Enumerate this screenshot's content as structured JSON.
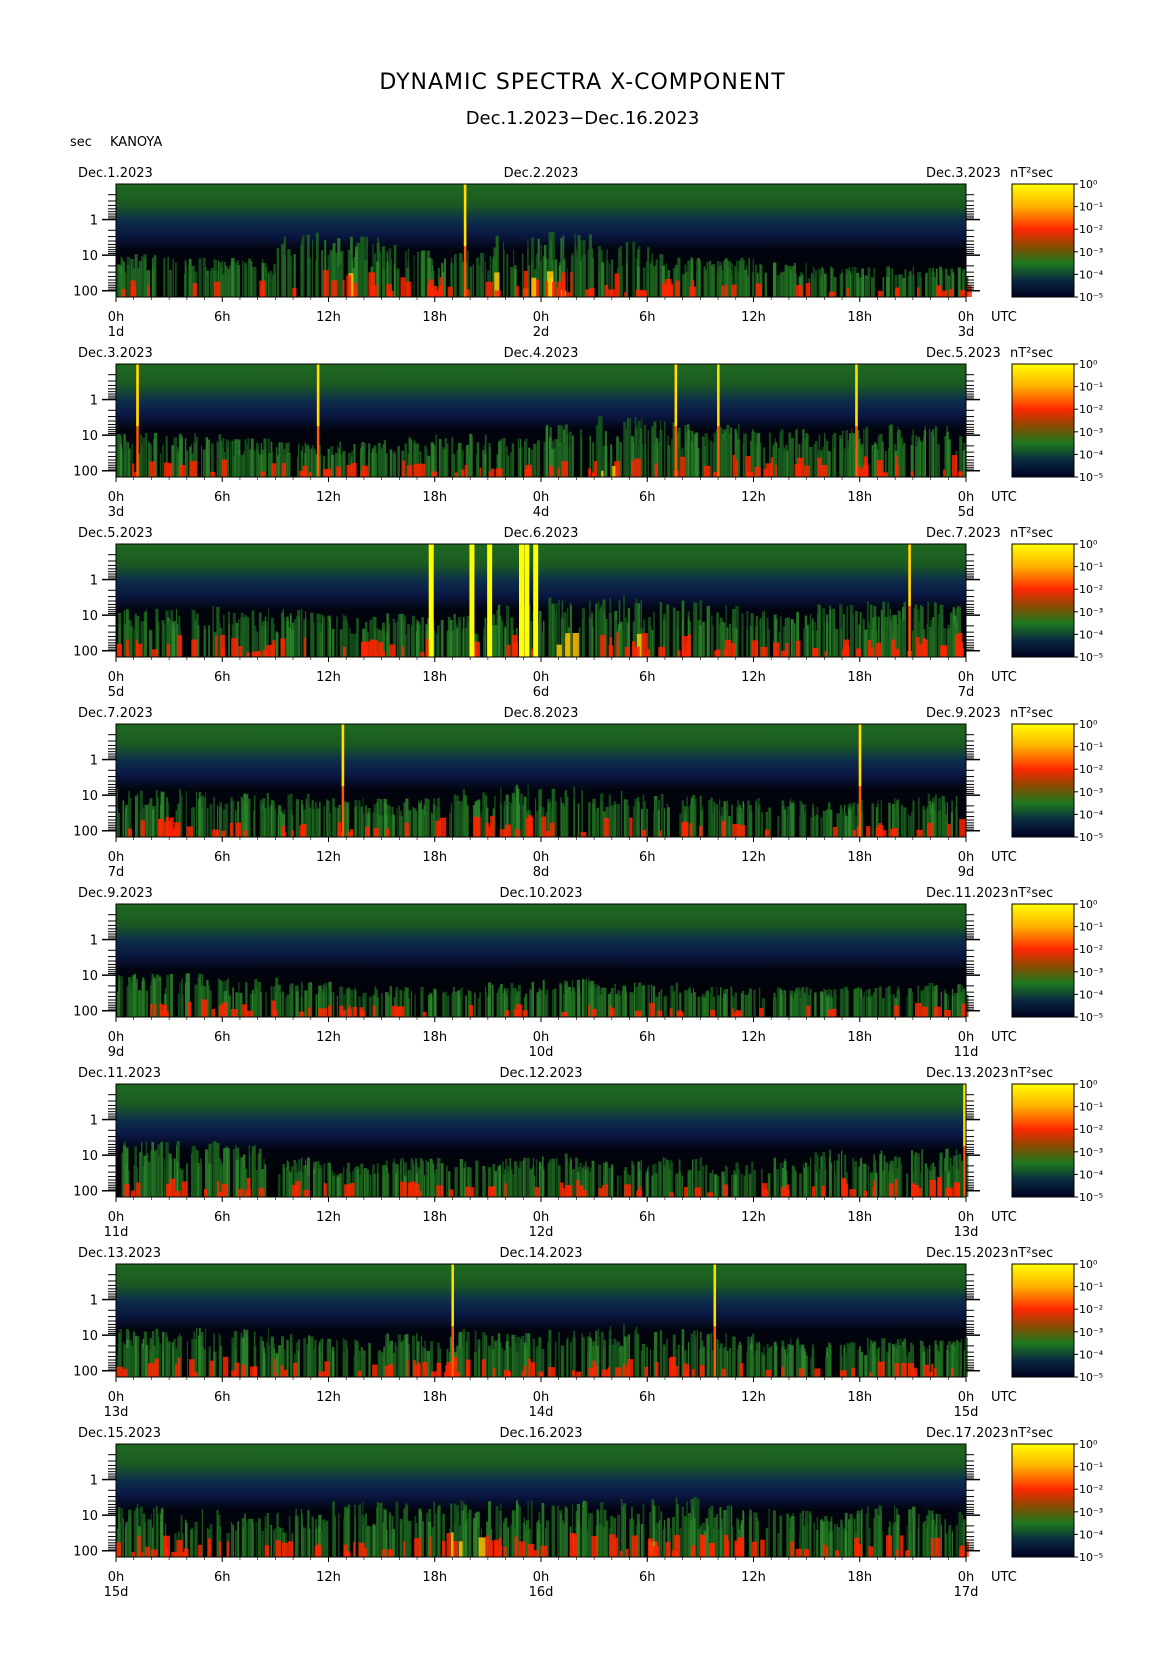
{
  "title": "DYNAMIC SPECTRA X-COMPONENT",
  "subtitle": "Dec.1.2023−Dec.16.2023",
  "ylabel": "sec",
  "station": "KANOYA",
  "colorbar_unit": "nT²sec",
  "colorbar_ticks": [
    "10⁰",
    "10⁻¹",
    "10⁻²",
    "10⁻³",
    "10⁻⁴",
    "10⁻⁵"
  ],
  "x_tick_labels": [
    "0h",
    "6h",
    "12h",
    "18h",
    "0h",
    "6h",
    "12h",
    "18h",
    "0h"
  ],
  "utc_label": "UTC",
  "y_tick_labels": [
    "1",
    "10",
    "100"
  ],
  "colors": {
    "background": "#000000",
    "low": "#0a1a55",
    "mid": "#1e6a1e",
    "high": "#ff2800",
    "max": "#ffff00"
  },
  "chart_data": {
    "type": "heatmap",
    "title": "DYNAMIC SPECTRA X-COMPONENT",
    "subtitle": "Dec.1.2023−Dec.16.2023",
    "ylabel": "sec",
    "ylim": [
      0.1,
      200
    ],
    "y_scale": "log",
    "y_ticks": [
      1,
      10,
      100
    ],
    "color_scale": {
      "min": "10⁻⁵",
      "max": "10⁰",
      "unit": "nT²sec"
    },
    "panels": [
      {
        "left_date": "Dec.1.2023",
        "mid_date": "Dec.2.2023",
        "right_date": "Dec.3.2023",
        "day_labels": [
          "1d",
          "2d",
          "3d"
        ],
        "activity": [
          0.35,
          0.3,
          0.3,
          0.6,
          0.55,
          0.45,
          0.4,
          0.55,
          0.6,
          0.5,
          0.35,
          0.3,
          0.25,
          0.2,
          0.2,
          0.2
        ],
        "spikes": []
      },
      {
        "left_date": "Dec.3.2023",
        "mid_date": "Dec.4.2023",
        "right_date": "Dec.5.2023",
        "day_labels": [
          "3d",
          "4d",
          "5d"
        ],
        "activity": [
          0.35,
          0.35,
          0.3,
          0.25,
          0.25,
          0.3,
          0.35,
          0.3,
          0.45,
          0.55,
          0.5,
          0.45,
          0.4,
          0.4,
          0.45,
          0.45
        ],
        "spikes": []
      },
      {
        "left_date": "Dec.5.2023",
        "mid_date": "Dec.6.2023",
        "right_date": "Dec.7.2023",
        "day_labels": [
          "5d",
          "6d",
          "7d"
        ],
        "activity": [
          0.4,
          0.45,
          0.4,
          0.4,
          0.35,
          0.35,
          0.35,
          0.45,
          0.55,
          0.55,
          0.5,
          0.45,
          0.4,
          0.45,
          0.5,
          0.5
        ],
        "spikes": [
          17.8,
          20.1,
          21.1,
          22.9,
          23.2,
          23.7
        ]
      },
      {
        "left_date": "Dec.7.2023",
        "mid_date": "Dec.8.2023",
        "right_date": "Dec.9.2023",
        "day_labels": [
          "7d",
          "8d",
          "9d"
        ],
        "activity": [
          0.4,
          0.4,
          0.35,
          0.35,
          0.3,
          0.3,
          0.4,
          0.45,
          0.45,
          0.4,
          0.35,
          0.3,
          0.3,
          0.25,
          0.3,
          0.35
        ],
        "spikes": []
      },
      {
        "left_date": "Dec.9.2023",
        "mid_date": "Dec.10.2023",
        "right_date": "Dec.11.2023",
        "day_labels": [
          "9d",
          "10d",
          "11d"
        ],
        "activity": [
          0.35,
          0.35,
          0.3,
          0.25,
          0.2,
          0.2,
          0.2,
          0.25,
          0.3,
          0.25,
          0.25,
          0.2,
          0.2,
          0.2,
          0.2,
          0.25
        ],
        "spikes": []
      },
      {
        "left_date": "Dec.11.2023",
        "mid_date": "Dec.12.2023",
        "right_date": "Dec.13.2023",
        "day_labels": [
          "11d",
          "12d",
          "13d"
        ],
        "activity": [
          0.5,
          0.5,
          0.45,
          0.3,
          0.25,
          0.3,
          0.3,
          0.3,
          0.35,
          0.3,
          0.3,
          0.25,
          0.3,
          0.4,
          0.4,
          0.4
        ],
        "spikes": []
      },
      {
        "left_date": "Dec.13.2023",
        "mid_date": "Dec.14.2023",
        "right_date": "Dec.15.2023",
        "day_labels": [
          "13d",
          "14d",
          "15d"
        ],
        "activity": [
          0.4,
          0.45,
          0.4,
          0.35,
          0.3,
          0.35,
          0.4,
          0.35,
          0.4,
          0.45,
          0.4,
          0.35,
          0.3,
          0.25,
          0.3,
          0.3
        ],
        "spikes": []
      },
      {
        "left_date": "Dec.15.2023",
        "mid_date": "Dec.16.2023",
        "right_date": "Dec.17.2023",
        "day_labels": [
          "15d",
          "16d",
          "17d"
        ],
        "activity": [
          0.45,
          0.4,
          0.35,
          0.4,
          0.5,
          0.5,
          0.55,
          0.5,
          0.5,
          0.55,
          0.55,
          0.45,
          0.4,
          0.4,
          0.45,
          0.4
        ],
        "spikes": []
      }
    ],
    "thin_spikes": [
      [
        19.7
      ],
      [
        1.2,
        11.4,
        31.6,
        34.0,
        41.8
      ],
      [
        44.8
      ],
      [
        12.8,
        42.0
      ],
      [],
      [
        47.9
      ],
      [
        19.0,
        33.8
      ],
      []
    ]
  }
}
